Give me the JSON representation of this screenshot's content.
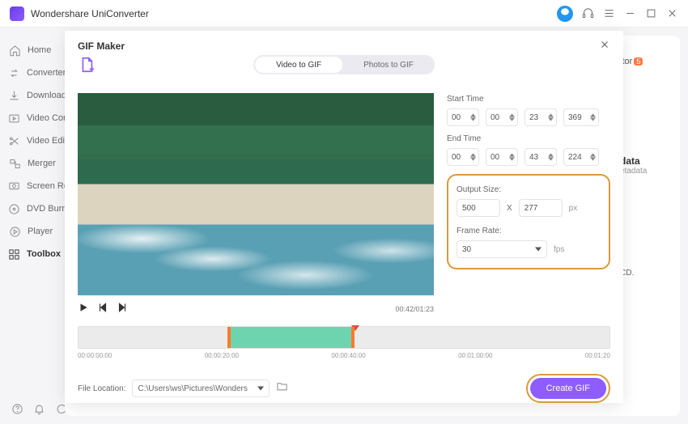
{
  "app": {
    "title": "Wondershare UniConverter"
  },
  "sidebar": {
    "items": [
      {
        "label": "Home"
      },
      {
        "label": "Converter"
      },
      {
        "label": "Downloader"
      },
      {
        "label": "Video Compressor"
      },
      {
        "label": "Video Editor"
      },
      {
        "label": "Merger"
      },
      {
        "label": "Screen Recorder"
      },
      {
        "label": "DVD Burner"
      },
      {
        "label": "Player"
      },
      {
        "label": "Toolbox"
      }
    ]
  },
  "ghost": {
    "tor_label": "itor",
    "badge": "5",
    "data_title": "data",
    "etadata": "etadata",
    "cd": "CD."
  },
  "modal": {
    "title": "GIF Maker",
    "tabs": {
      "video": "Video to GIF",
      "photos": "Photos to GIF"
    },
    "start_label": "Start Time",
    "end_label": "End Time",
    "start": {
      "h": "00",
      "m": "00",
      "s": "23",
      "ms": "369"
    },
    "end": {
      "h": "00",
      "m": "00",
      "s": "43",
      "ms": "224"
    },
    "output_size_label": "Output Size:",
    "size": {
      "w": "500",
      "x": "X",
      "h": "277",
      "unit": "px"
    },
    "frame_rate_label": "Frame Rate:",
    "frame_rate": {
      "value": "30",
      "unit": "fps"
    },
    "time": "00:42/01:23",
    "ticks": [
      "00:00:00:00",
      "00:00:20:00",
      "00:00:40:00",
      "00:01:00:00",
      "00:01:20"
    ],
    "file_location_label": "File Location:",
    "file_location": "C:\\Users\\ws\\Pictures\\Wonders",
    "create_label": "Create GIF"
  }
}
